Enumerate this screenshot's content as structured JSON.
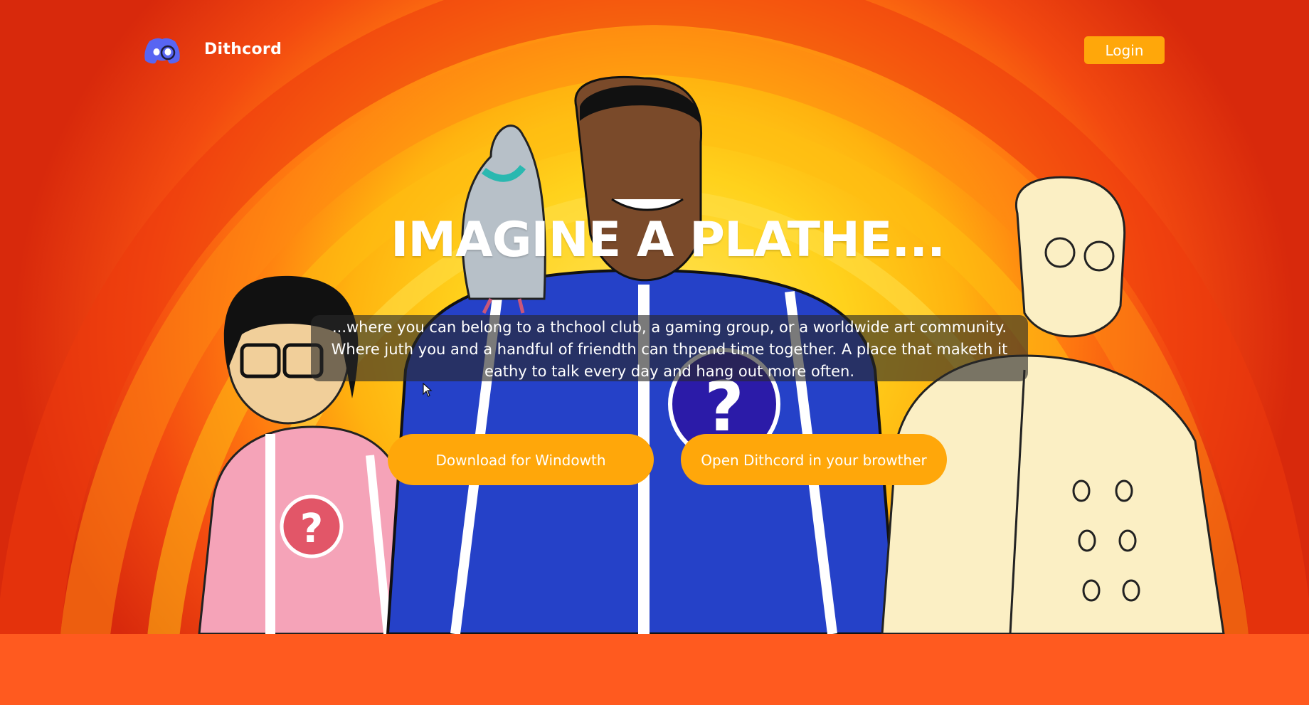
{
  "nav": {
    "brand": "Dithcord",
    "logo_icon": "discord-logo-icon",
    "login_label": "Login"
  },
  "hero": {
    "headline": "IMAGINE A PLATHE...",
    "tagline": "...where you can belong to a thchool club, a gaming group, or a worldwide art community. Where juth you and a handful of friendth can thpend time together. A place that maketh it eathy to talk every day and hang out more often.",
    "download_label": "Download for Windowth",
    "browser_label": "Open Dithcord in your browther"
  },
  "colors": {
    "accent": "#ffa70a",
    "footer_band": "#ff5a1f",
    "brand_blurple": "#5865f2"
  }
}
